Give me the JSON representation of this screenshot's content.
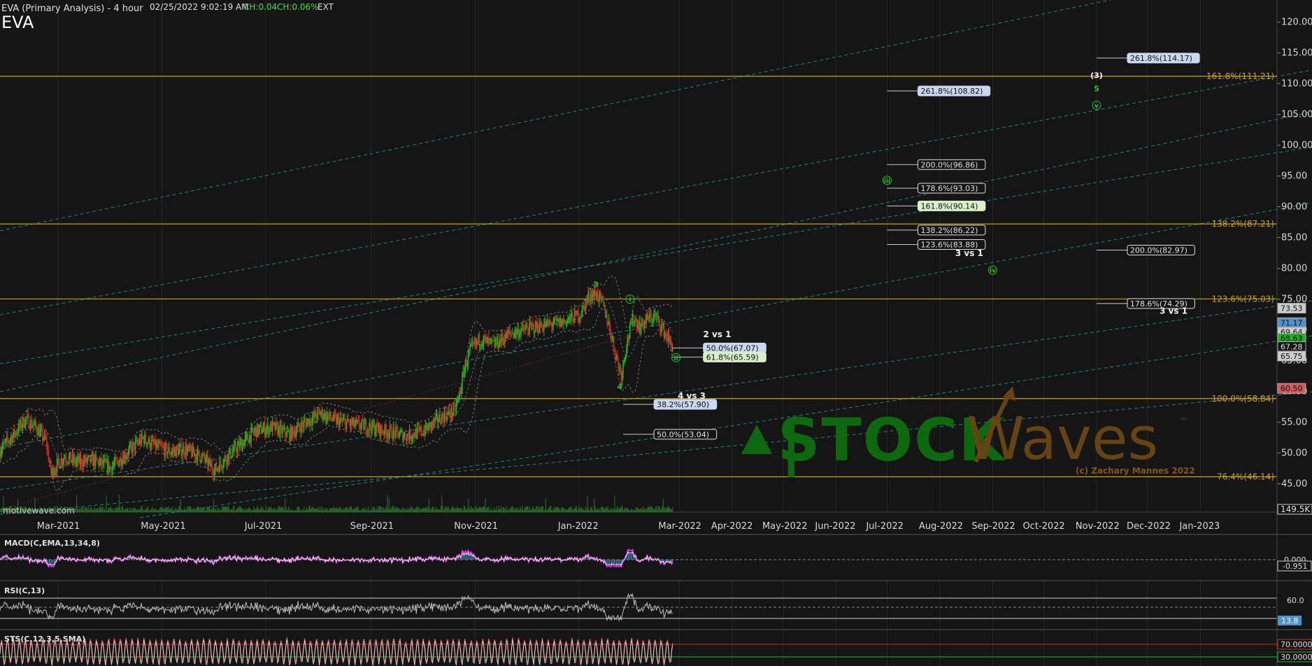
{
  "header": {
    "title": "EVA (Primary Analysis) - 4 hour",
    "datetime": "02/25/2022 9:02:19 AM",
    "change": "CH:0.04",
    "change_pct": "CH:0.06%",
    "session": "EXT",
    "symbol": "EVA"
  },
  "watermark": {
    "source": "motivewave.com",
    "brand_left": "STOCK",
    "brand_right": "Waves",
    "tm": "™",
    "copyright": "(c) Zachary Mannes 2022"
  },
  "colors": {
    "background": "#151515",
    "grid": "#262626",
    "fib_line": "#c8a020",
    "channel": "#1f9a96",
    "wave_label": "#21c521",
    "up_candle": "#21b021",
    "down_candle": "#d02525",
    "macd_line": "#ff30ff",
    "macd_hist": "#4f93c8",
    "brand_green": "#0d6e0d",
    "brand_brown": "#6b4712"
  },
  "chart_data": {
    "type": "candlestick",
    "title": "EVA (Primary Analysis) - 4 hour",
    "x_axis": {
      "type": "date",
      "range": [
        "2021-01-26",
        "2023-02-15"
      ],
      "tick_labels": [
        "Mar-2021",
        "May-2021",
        "Jul-2021",
        "Sep-2021",
        "Nov-2021",
        "Jan-2022",
        "Mar-2022",
        "Apr-2022",
        "May-2022",
        "Jun-2022",
        "Jul-2022",
        "Aug-2022",
        "Sep-2022",
        "Oct-2022",
        "Nov-2022",
        "Dec-2022",
        "Jan-2023"
      ],
      "tick_dates": [
        "2021-03-01",
        "2021-05-01",
        "2021-07-01",
        "2021-09-01",
        "2021-11-01",
        "2022-01-01",
        "2022-03-01",
        "2022-04-01",
        "2022-05-01",
        "2022-06-01",
        "2022-07-01",
        "2022-08-01",
        "2022-09-01",
        "2022-10-01",
        "2022-11-01",
        "2022-12-01",
        "2023-01-01"
      ]
    },
    "y_axis": {
      "range": [
        40.4,
        123.6
      ],
      "ticks": [
        45,
        50,
        55,
        60,
        65,
        70,
        75,
        80,
        85,
        90,
        95,
        100,
        105,
        110,
        115,
        120
      ],
      "tick_labels": [
        "45.00",
        "50.00",
        "55.00",
        "60.00",
        "65.00",
        "70.00",
        "75.00",
        "80.00",
        "85.00",
        "90.00",
        "95.00",
        "100.00",
        "105.00",
        "110.00",
        "115.00",
        "120.00"
      ],
      "volume_label": "149.5K"
    },
    "price_path": [
      [
        "2021-01-26",
        50.5
      ],
      [
        "2021-02-03",
        53.0
      ],
      [
        "2021-02-10",
        55.5
      ],
      [
        "2021-02-16",
        54.2
      ],
      [
        "2021-02-22",
        52.0
      ],
      [
        "2021-02-25",
        46.8
      ],
      [
        "2021-03-05",
        49.5
      ],
      [
        "2021-03-12",
        48.5
      ],
      [
        "2021-03-22",
        48.8
      ],
      [
        "2021-04-01",
        47.6
      ],
      [
        "2021-04-10",
        49.8
      ],
      [
        "2021-04-20",
        52.4
      ],
      [
        "2021-04-28",
        51.0
      ],
      [
        "2021-05-06",
        50.2
      ],
      [
        "2021-05-14",
        50.6
      ],
      [
        "2021-05-24",
        49.5
      ],
      [
        "2021-06-01",
        47.2
      ],
      [
        "2021-06-08",
        49.3
      ],
      [
        "2021-06-18",
        51.8
      ],
      [
        "2021-06-25",
        53.6
      ],
      [
        "2021-07-05",
        54.2
      ],
      [
        "2021-07-15",
        53.0
      ],
      [
        "2021-07-25",
        55.0
      ],
      [
        "2021-08-02",
        56.5
      ],
      [
        "2021-08-12",
        55.2
      ],
      [
        "2021-08-22",
        54.6
      ],
      [
        "2021-09-01",
        54.2
      ],
      [
        "2021-09-12",
        53.4
      ],
      [
        "2021-09-22",
        52.8
      ],
      [
        "2021-10-02",
        53.6
      ],
      [
        "2021-10-12",
        55.8
      ],
      [
        "2021-10-20",
        56.8
      ],
      [
        "2021-10-23",
        59.5
      ],
      [
        "2021-10-26",
        64.0
      ],
      [
        "2021-10-29",
        66.5
      ],
      [
        "2021-11-04",
        68.5
      ],
      [
        "2021-11-12",
        67.5
      ],
      [
        "2021-11-22",
        69.5
      ],
      [
        "2021-12-02",
        70.2
      ],
      [
        "2021-12-12",
        70.8
      ],
      [
        "2021-12-22",
        71.2
      ],
      [
        "2022-01-02",
        72.6
      ],
      [
        "2022-01-07",
        75.5
      ],
      [
        "2022-01-11",
        76.0
      ],
      [
        "2022-01-15",
        74.2
      ],
      [
        "2022-01-19",
        70.5
      ],
      [
        "2022-01-24",
        64.5
      ],
      [
        "2022-01-26",
        62.8
      ],
      [
        "2022-01-29",
        67.8
      ],
      [
        "2022-02-02",
        72.0
      ],
      [
        "2022-02-06",
        70.5
      ],
      [
        "2022-02-10",
        71.8
      ],
      [
        "2022-02-15",
        72.2
      ],
      [
        "2022-02-20",
        69.8
      ],
      [
        "2022-02-25",
        67.3
      ]
    ],
    "last_price": 67.28,
    "price_labels": [
      {
        "value": 73.53,
        "text": "73.53"
      },
      {
        "value": 71.17,
        "text": "71.17"
      },
      {
        "value": 69.64,
        "text": "69.64"
      },
      {
        "value": 68.63,
        "text": "68.63"
      },
      {
        "value": 67.28,
        "text": "67.28"
      },
      {
        "value": 65.75,
        "text": "65.75"
      },
      {
        "value": 60.5,
        "text": "60.50"
      }
    ],
    "fib_levels": [
      {
        "value": 111.21,
        "text": "161.8%(111.21)"
      },
      {
        "value": 87.21,
        "text": "138.2%(87.21)"
      },
      {
        "value": 75.03,
        "text": "123.6%(75.03)"
      },
      {
        "value": 58.84,
        "text": "100.0%(58.84)"
      },
      {
        "value": 46.14,
        "text": "76.4%(46.14)"
      }
    ],
    "projection_labels": [
      {
        "date": "2022-11-01",
        "value": 114.17,
        "text": "261.8%(114.17)",
        "style": "blue"
      },
      {
        "date": "2022-07-01",
        "value": 108.82,
        "text": "261.8%(108.82)",
        "style": "blue"
      },
      {
        "date": "2022-07-01",
        "value": 96.86,
        "text": "200.0%(96.86)",
        "style": "dark"
      },
      {
        "date": "2022-07-01",
        "value": 93.03,
        "text": "178.6%(93.03)",
        "style": "dark"
      },
      {
        "date": "2022-07-01",
        "value": 90.14,
        "text": "161.8%(90.14)",
        "style": "green"
      },
      {
        "date": "2022-07-01",
        "value": 86.22,
        "text": "138.2%(86.22)",
        "style": "dark"
      },
      {
        "date": "2022-07-01",
        "value": 83.88,
        "text": "123.6%(83.88)",
        "style": "dark"
      },
      {
        "date": "2022-11-01",
        "value": 82.97,
        "text": "200.0%(82.97)",
        "style": "dark"
      },
      {
        "date": "2022-11-01",
        "value": 74.29,
        "text": "178.6%(74.29)",
        "style": "dark"
      },
      {
        "date": "2022-02-25",
        "value": 67.07,
        "text": "50.0%(67.07)",
        "style": "blue"
      },
      {
        "date": "2022-02-25",
        "value": 65.59,
        "text": "61.8%(65.59)",
        "style": "green"
      },
      {
        "date": "2022-01-27",
        "value": 57.9,
        "text": "38.2%(57.90)",
        "style": "blue"
      },
      {
        "date": "2022-01-27",
        "value": 53.04,
        "text": "50.0%(53.04)",
        "style": "dark"
      }
    ],
    "annotations": [
      {
        "date": "2022-03-15",
        "value": 68.8,
        "text": "2 vs 1"
      },
      {
        "date": "2022-02-28",
        "value": 58.8,
        "text": "4 vs 3"
      },
      {
        "date": "2022-08-10",
        "value": 82.0,
        "text": "3 vs 1"
      },
      {
        "date": "2022-12-08",
        "value": 72.6,
        "text": "3 vs 1"
      }
    ],
    "wave_labels": [
      {
        "date": "2022-01-11",
        "value": 77.4,
        "text": "3"
      },
      {
        "date": "2022-01-25",
        "value": 60.8,
        "text": "4"
      },
      {
        "date": "2022-01-31",
        "value": 75.0,
        "text": "i",
        "circled": true
      },
      {
        "date": "2022-02-27",
        "value": 65.5,
        "text": "ii",
        "circled": true
      },
      {
        "date": "2022-07-01",
        "value": 94.3,
        "text": "iii",
        "circled": true
      },
      {
        "date": "2022-09-01",
        "value": 79.7,
        "text": "iv",
        "circled": true
      },
      {
        "date": "2022-11-01",
        "value": 106.5,
        "text": "v",
        "circled": true
      },
      {
        "date": "2022-11-01",
        "value": 109.2,
        "text": "5"
      },
      {
        "date": "2022-11-01",
        "value": 111.4,
        "text": "(3)",
        "color": "white"
      }
    ],
    "indicators": {
      "macd": {
        "label": "MACD(C,EMA,13,34,8)",
        "ticks": [
          "0.000",
          "-0.951"
        ]
      },
      "rsi": {
        "label": "RSI(C,13)",
        "ticks": [
          "60.0",
          "13.8"
        ]
      },
      "stochastic": {
        "label": "STS(C,12,3,5,SMA)",
        "ticks": [
          "70.0000",
          "30.0000"
        ]
      }
    }
  }
}
